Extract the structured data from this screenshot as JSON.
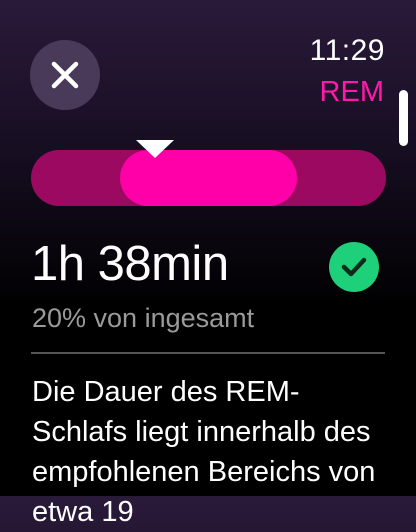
{
  "header": {
    "time": "11:29",
    "stage": "REM"
  },
  "icons": {
    "close": "close-icon",
    "check": "checkmark-icon"
  },
  "range": {
    "recommended_start": 0.25,
    "recommended_end": 0.75,
    "value": 0.35
  },
  "summary": {
    "duration": "1h 38min",
    "percent_text": "20% von ingesamt"
  },
  "description": {
    "text": "Die Dauer des REM-Schlafs liegt innerhalb des empfohlenen Bereichs von etwa 19"
  },
  "colors": {
    "accent": "#ff1aa9",
    "range_fill": "#ff00a8",
    "range_track": "#9b0a60",
    "success": "#1fd07a"
  }
}
